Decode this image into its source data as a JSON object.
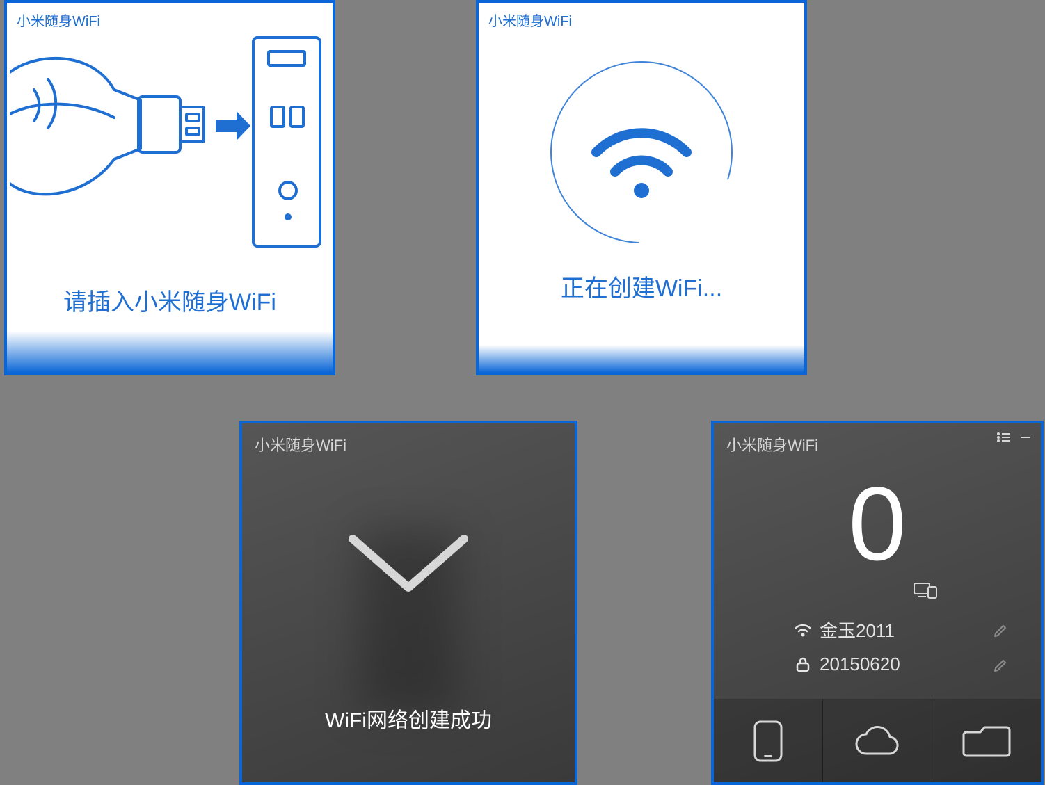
{
  "app_title": "小米随身WiFi",
  "panel1": {
    "caption": "请插入小米随身WiFi"
  },
  "panel2": {
    "caption": "正在创建WiFi..."
  },
  "panel3": {
    "caption": "WiFi网络创建成功"
  },
  "panel4": {
    "connected_count": "0",
    "ssid": "金玉2011",
    "password": "20150620"
  },
  "colors": {
    "brand_blue": "#1f6fd3",
    "frame_blue": "#0a66d6"
  }
}
